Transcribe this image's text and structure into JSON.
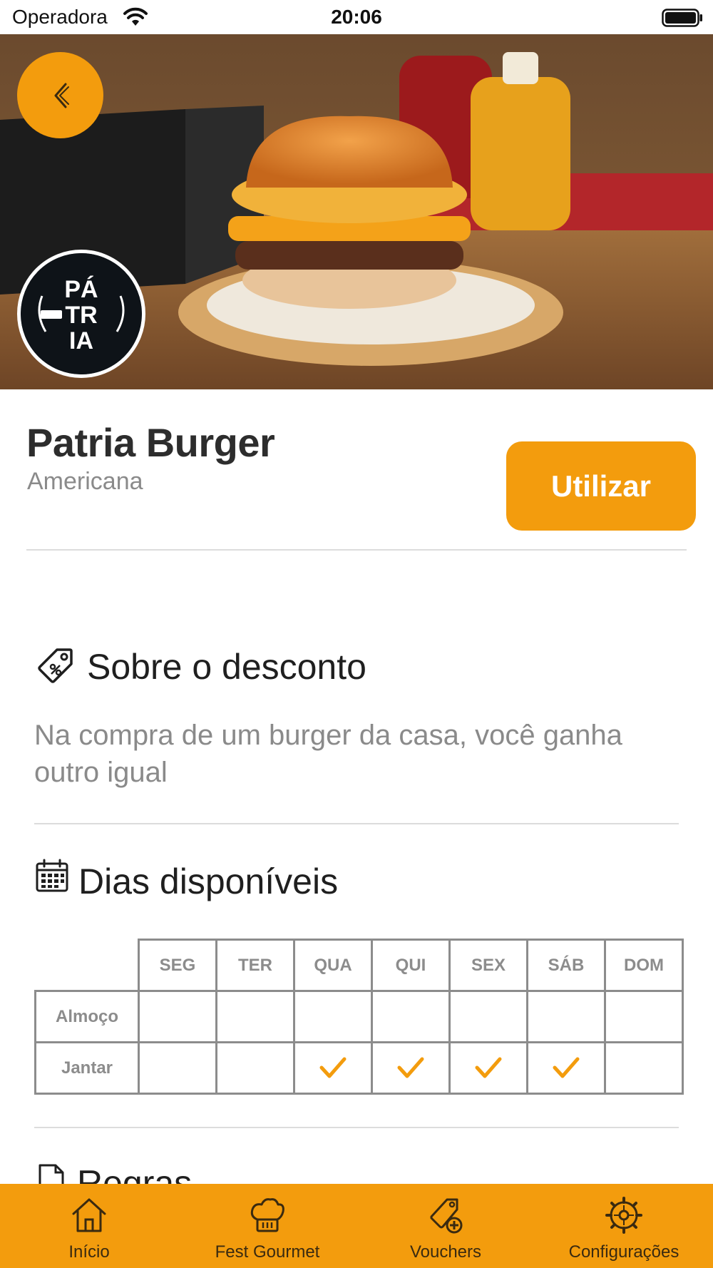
{
  "status_bar": {
    "carrier": "Operadora",
    "time": "20:06"
  },
  "restaurant": {
    "name": "Patria Burger",
    "category": "Americana",
    "use_button_label": "Utilizar",
    "logo_text": "PÁTRIA BURGER"
  },
  "about": {
    "title": "Sobre o desconto",
    "description": "Na compra de um burger da casa, você ganha outro igual"
  },
  "schedule": {
    "title": "Dias disponíveis",
    "days": [
      "SEG",
      "TER",
      "QUA",
      "QUI",
      "SEX",
      "SÁB",
      "DOM"
    ],
    "rows": [
      {
        "label": "Almoço",
        "available": [
          false,
          false,
          false,
          false,
          false,
          false,
          false
        ]
      },
      {
        "label": "Jantar",
        "available": [
          false,
          false,
          true,
          true,
          true,
          true,
          false
        ]
      }
    ]
  },
  "rules": {
    "title": "Regras"
  },
  "tabs": [
    {
      "label": "Início",
      "icon": "home-icon"
    },
    {
      "label": "Fest Gourmet",
      "icon": "chef-hat-icon"
    },
    {
      "label": "Vouchers",
      "icon": "voucher-add-icon"
    },
    {
      "label": "Configurações",
      "icon": "gear-icon"
    }
  ],
  "colors": {
    "accent": "#f39c0d",
    "text_dark": "#2d2d2d",
    "text_muted": "#8a8a8a",
    "table_border": "#8c8c8c"
  }
}
